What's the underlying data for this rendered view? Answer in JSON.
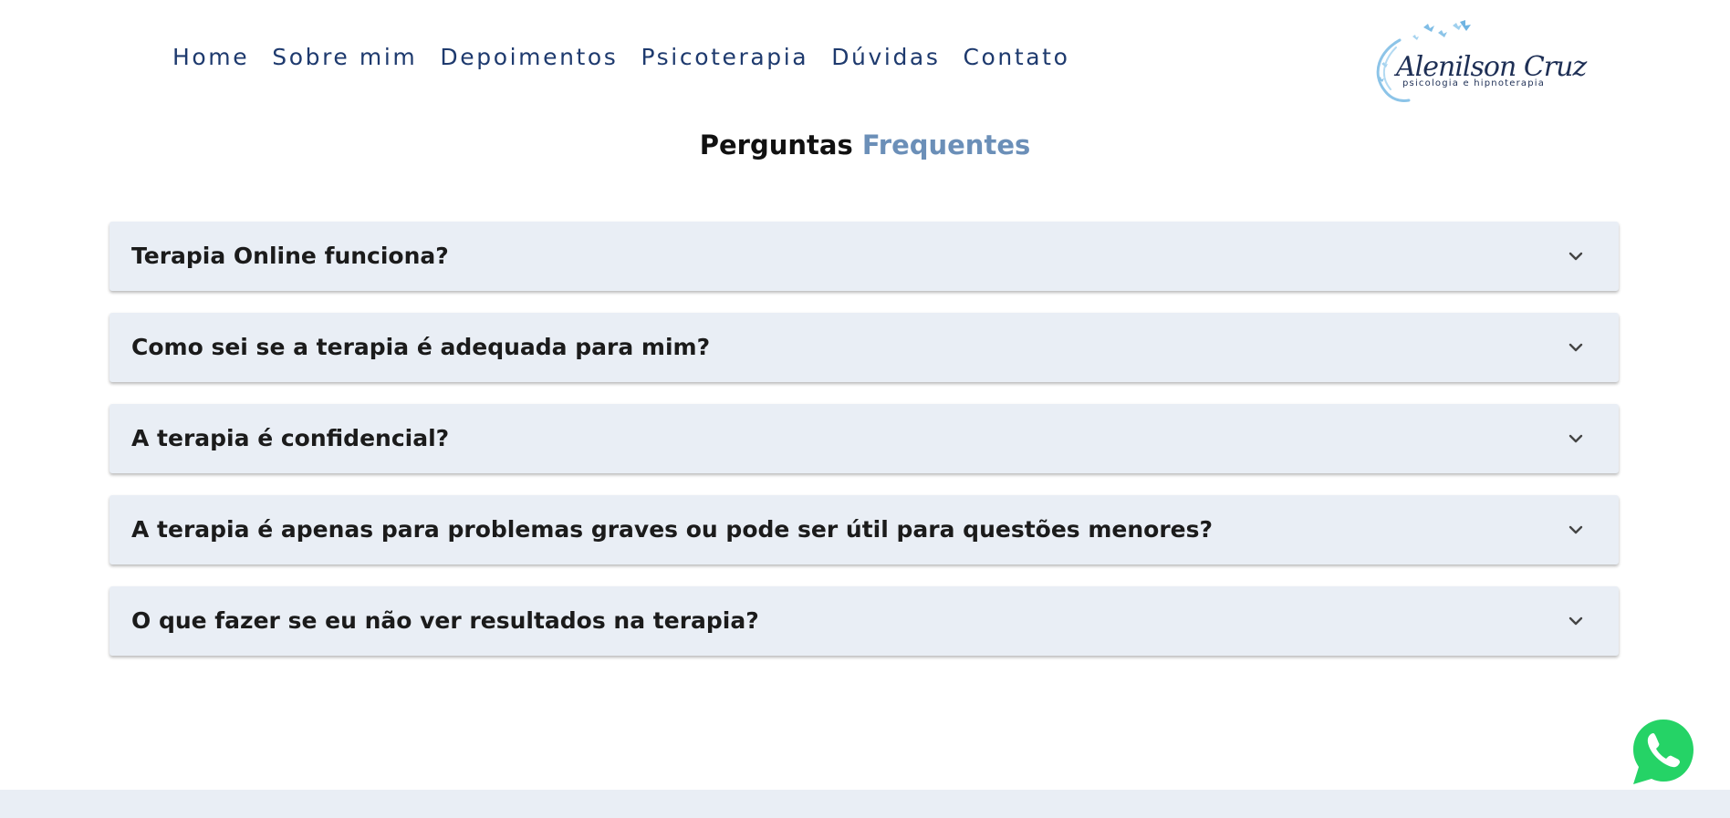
{
  "nav": {
    "items": [
      {
        "label": "Home"
      },
      {
        "label": "Sobre mim"
      },
      {
        "label": "Depoimentos"
      },
      {
        "label": "Psicoterapia"
      },
      {
        "label": "Dúvidas"
      },
      {
        "label": "Contato"
      }
    ]
  },
  "logo": {
    "name": "Alenilson Cruz",
    "tagline": "psicologia e hipnoterapia"
  },
  "faq": {
    "title_main": "Perguntas",
    "title_accent": "Frequentes",
    "items": [
      {
        "question": "Terapia Online funciona?"
      },
      {
        "question": "Como sei se a terapia é adequada para mim?"
      },
      {
        "question": "A terapia é confidencial?"
      },
      {
        "question": "A terapia é apenas para problemas graves ou pode ser útil para questões menores?"
      },
      {
        "question": "O que fazer se eu não ver resultados na terapia?"
      }
    ]
  },
  "colors": {
    "nav_text": "#1e3a6e",
    "title_accent": "#6b8fb8",
    "faq_background": "#e9eef5",
    "whatsapp_green": "#25d366"
  },
  "icons": {
    "faq_toggle": "chevron-down-icon",
    "floating_button": "whatsapp-icon"
  }
}
